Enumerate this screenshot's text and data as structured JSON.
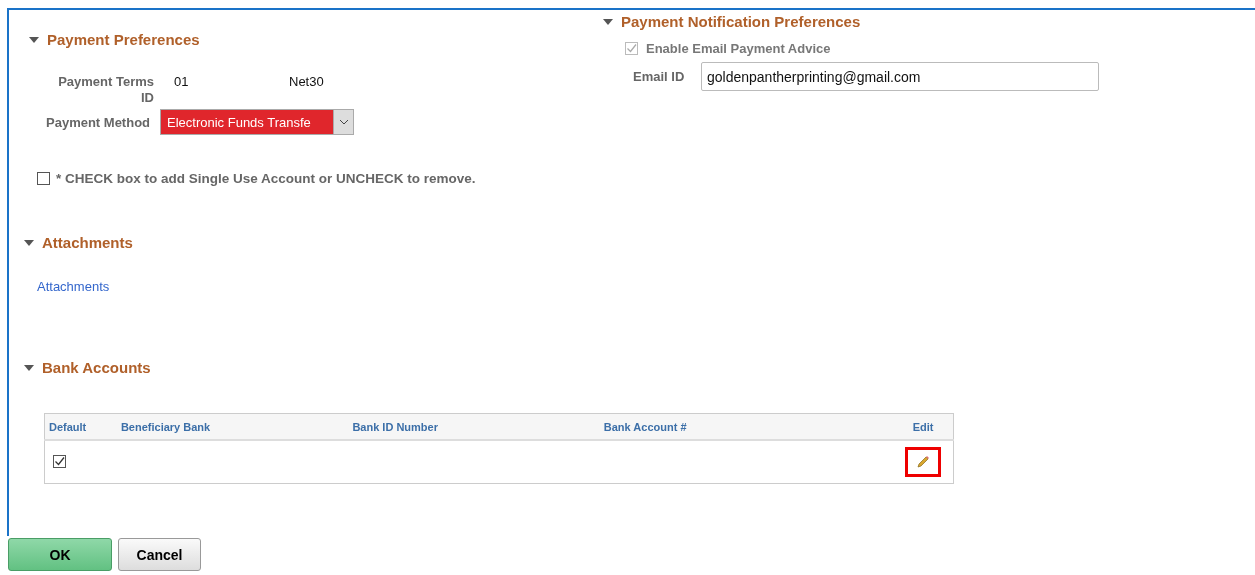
{
  "payment_preferences": {
    "title": "Payment Preferences",
    "expanded": true,
    "terms_label": "Payment Terms ID",
    "terms_id": "01",
    "terms_name": "Net30",
    "method_label": "Payment Method",
    "method_value": "Electronic Funds Transfe",
    "single_use": {
      "label": "* CHECK box to add Single Use Account or UNCHECK to remove.",
      "checked": false
    }
  },
  "notification": {
    "title": "Payment Notification Preferences",
    "expanded": true,
    "email_advice": {
      "label": "Enable Email Payment Advice",
      "checked": true,
      "disabled": true
    },
    "email_label": "Email ID",
    "email_value": "goldenpantherprinting@gmail.com"
  },
  "attachments": {
    "title": "Attachments",
    "expanded": true,
    "link": "Attachments"
  },
  "bank_accounts": {
    "title": "Bank Accounts",
    "expanded": true,
    "columns": [
      "Default",
      "Beneficiary Bank",
      "Bank ID Number",
      "Bank Account #",
      "Edit"
    ],
    "rows": [
      {
        "default": true,
        "highlighted": true
      }
    ]
  },
  "buttons": [
    {
      "label": "OK",
      "kind": "primary"
    },
    {
      "label": "Cancel",
      "kind": "secondary"
    }
  ]
}
